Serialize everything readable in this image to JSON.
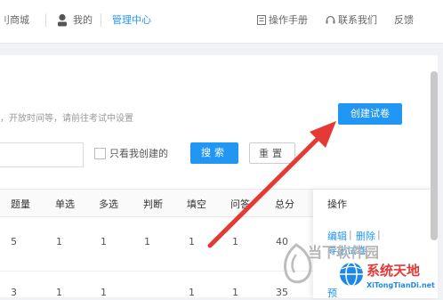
{
  "nav": {
    "store": "刂商城",
    "mine": "我的",
    "admin": "管理中心",
    "manual": "操作手册",
    "contact": "联系我们",
    "feedback": "反馈"
  },
  "hint": "，开放时间等，请前往考试中设置",
  "create_button": "创建试卷",
  "filter": {
    "only_mine": "只看我创建的",
    "search": "搜索",
    "reset": "重置"
  },
  "table": {
    "headers": [
      "题量",
      "单选",
      "多选",
      "判断",
      "填空",
      "问答",
      "总分"
    ],
    "ops_header": "操作",
    "rows": [
      [
        "5",
        "1",
        "1",
        "1",
        "1",
        "1",
        "40"
      ],
      [
        "3",
        "1",
        "1",
        "",
        "1",
        "1",
        "35"
      ]
    ],
    "ops_links": [
      "编辑",
      "删除",
      "导出试卷"
    ],
    "ops_second": "预"
  },
  "watermark": {
    "text1": "当下软件园",
    "text2": "系统天地",
    "text3": "XiTongTianDi.net"
  },
  "colors": {
    "accent": "#2196f3",
    "arrow": "#e53935"
  }
}
